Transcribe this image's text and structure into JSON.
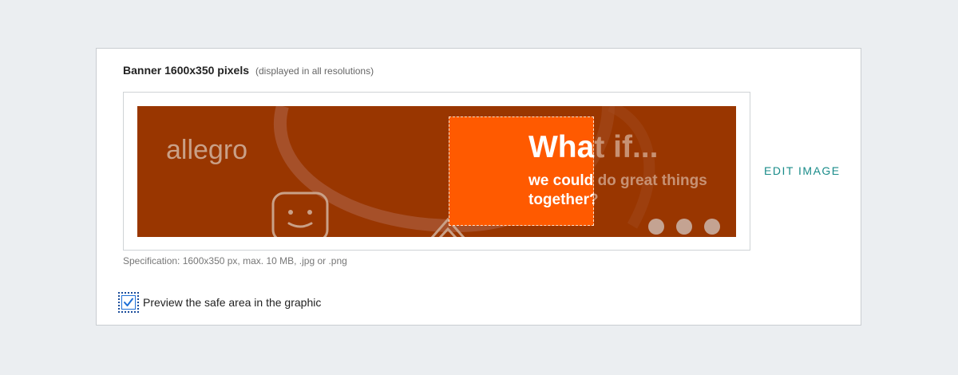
{
  "banner_section": {
    "title": "Banner 1600x350 pixels",
    "subtitle": "(displayed in all resolutions)",
    "edit_label": "EDIT IMAGE",
    "specification": "Specification: 1600x350 px, max. 10 MB, .jpg or .png"
  },
  "banner_image": {
    "logo_text": "allegro",
    "headline": "What if...",
    "subline": "we could do great things together?",
    "background_color": "#993600",
    "safe_area_color": "#ff5a00",
    "icons": [
      "smiley-icon",
      "arrow-icon",
      "dot-icon"
    ]
  },
  "safe_area_preview": {
    "label": "Preview the safe area in the graphic",
    "checked": true
  },
  "colors": {
    "accent_link": "#1a8c8a",
    "checkbox": "#1e6fd6",
    "page_background": "#ebeef1"
  }
}
